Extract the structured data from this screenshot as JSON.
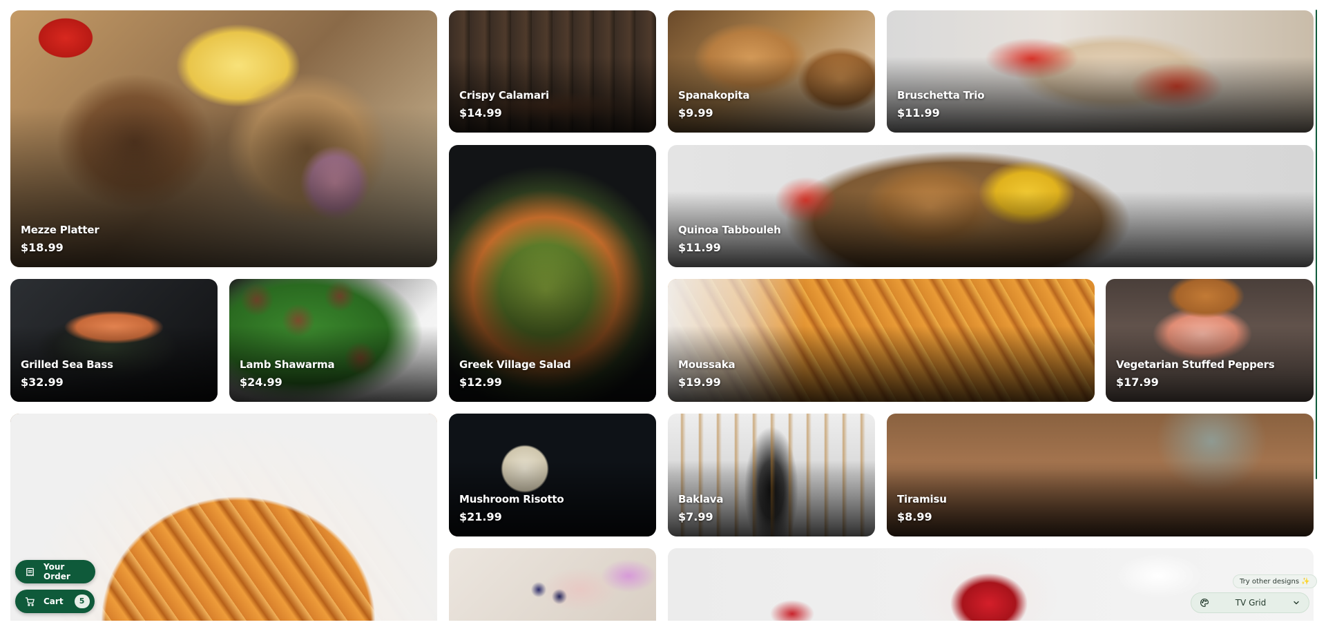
{
  "menu_items": [
    {
      "name": "Mezze Platter",
      "price": "$18.99"
    },
    {
      "name": "Crispy Calamari",
      "price": "$14.99"
    },
    {
      "name": "Spanakopita",
      "price": "$9.99"
    },
    {
      "name": "Bruschetta Trio",
      "price": "$11.99"
    },
    {
      "name": "Greek Village Salad",
      "price": "$12.99"
    },
    {
      "name": "Quinoa Tabbouleh",
      "price": "$11.99"
    },
    {
      "name": "Grilled Sea Bass",
      "price": "$32.99"
    },
    {
      "name": "Lamb Shawarma",
      "price": "$24.99"
    },
    {
      "name": "Moussaka",
      "price": "$19.99"
    },
    {
      "name": "Vegetarian Stuffed Peppers",
      "price": "$17.99"
    },
    {
      "name": "Mushroom Risotto",
      "price": "$21.99"
    },
    {
      "name": "Baklava",
      "price": "$7.99"
    },
    {
      "name": "Tiramisu",
      "price": "$8.99"
    }
  ],
  "order_button": {
    "label": "Your Order",
    "icon": "receipt-icon"
  },
  "cart_button": {
    "label": "Cart",
    "count": "5",
    "icon": "cart-icon"
  },
  "design_switcher": {
    "hint": "Try other designs ✨",
    "selected": "TV Grid",
    "icon": "palette-icon"
  },
  "colors": {
    "accent": "#0f5a3a",
    "tile_text": "#ffffff"
  }
}
